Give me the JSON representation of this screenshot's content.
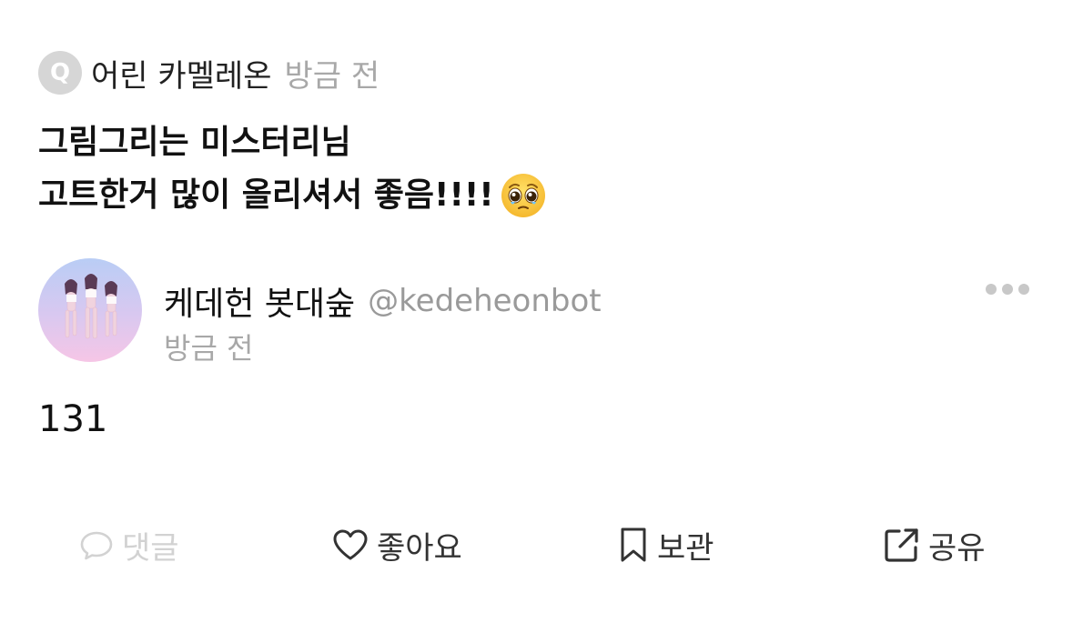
{
  "question": {
    "badge_letter": "Q",
    "asker": "어린 카멜레온",
    "time": "방금 전",
    "lines": [
      "그림그리는 미스터리님",
      "고트한거 많이 올리셔서 좋음!!!!"
    ],
    "emoji": "pleading-face-emoji"
  },
  "answer": {
    "author_name": "케데헌 봇대숲",
    "author_handle": "@kedeheonbot",
    "time": "방금 전",
    "text": "131"
  },
  "actions": {
    "comment_label": "댓글",
    "like_label": "좋아요",
    "save_label": "보관",
    "share_label": "공유"
  },
  "colors": {
    "badge_bg": "#d6d6d6",
    "muted_text": "#a8a8a8",
    "disabled": "#d2d2d2",
    "icon": "#333333"
  }
}
